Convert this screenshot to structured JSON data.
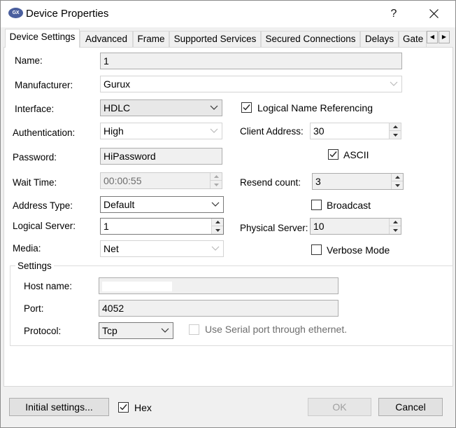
{
  "window": {
    "title": "Device Properties",
    "icon_text": "GX",
    "help_label": "?",
    "close_label": "✕"
  },
  "tabs": [
    {
      "label": "Device Settings",
      "active": true
    },
    {
      "label": "Advanced"
    },
    {
      "label": "Frame"
    },
    {
      "label": "Supported Services"
    },
    {
      "label": "Secured Connections"
    },
    {
      "label": "Delays"
    },
    {
      "label": "Gate"
    }
  ],
  "tab_scroll": {
    "left": "◀",
    "right": "▶"
  },
  "form": {
    "name_label": "Name:",
    "name_value": "1",
    "manufacturer_label": "Manufacturer:",
    "manufacturer_value": "Gurux",
    "interface_label": "Interface:",
    "interface_value": "HDLC",
    "authentication_label": "Authentication:",
    "authentication_value": "High",
    "password_label": "Password:",
    "password_value": "HiPassword",
    "wait_time_label": "Wait Time:",
    "wait_time_value": "00:00:55",
    "address_type_label": "Address Type:",
    "address_type_value": "Default",
    "logical_server_label": "Logical Server:",
    "logical_server_value": "1",
    "media_label": "Media:",
    "media_value": "Net",
    "logical_name_referencing_label": "Logical Name Referencing",
    "logical_name_referencing_checked": true,
    "client_address_label": "Client Address:",
    "client_address_value": "30",
    "ascii_label": "ASCII",
    "ascii_checked": true,
    "resend_count_label": "Resend count:",
    "resend_count_value": "3",
    "broadcast_label": "Broadcast",
    "broadcast_checked": false,
    "physical_server_label": "Physical Server:",
    "physical_server_value": "10",
    "verbose_mode_label": "Verbose Mode",
    "verbose_mode_checked": false
  },
  "settings": {
    "group_title": "Settings",
    "host_name_label": "Host name:",
    "host_name_value": "",
    "port_label": "Port:",
    "port_value": "4052",
    "protocol_label": "Protocol:",
    "protocol_value": "Tcp",
    "serial_through_ethernet_label": "Use Serial port through ethernet.",
    "serial_through_ethernet_checked": false
  },
  "footer": {
    "initial_settings_label": "Initial settings...",
    "hex_label": "Hex",
    "hex_checked": true,
    "ok_label": "OK",
    "cancel_label": "Cancel"
  }
}
